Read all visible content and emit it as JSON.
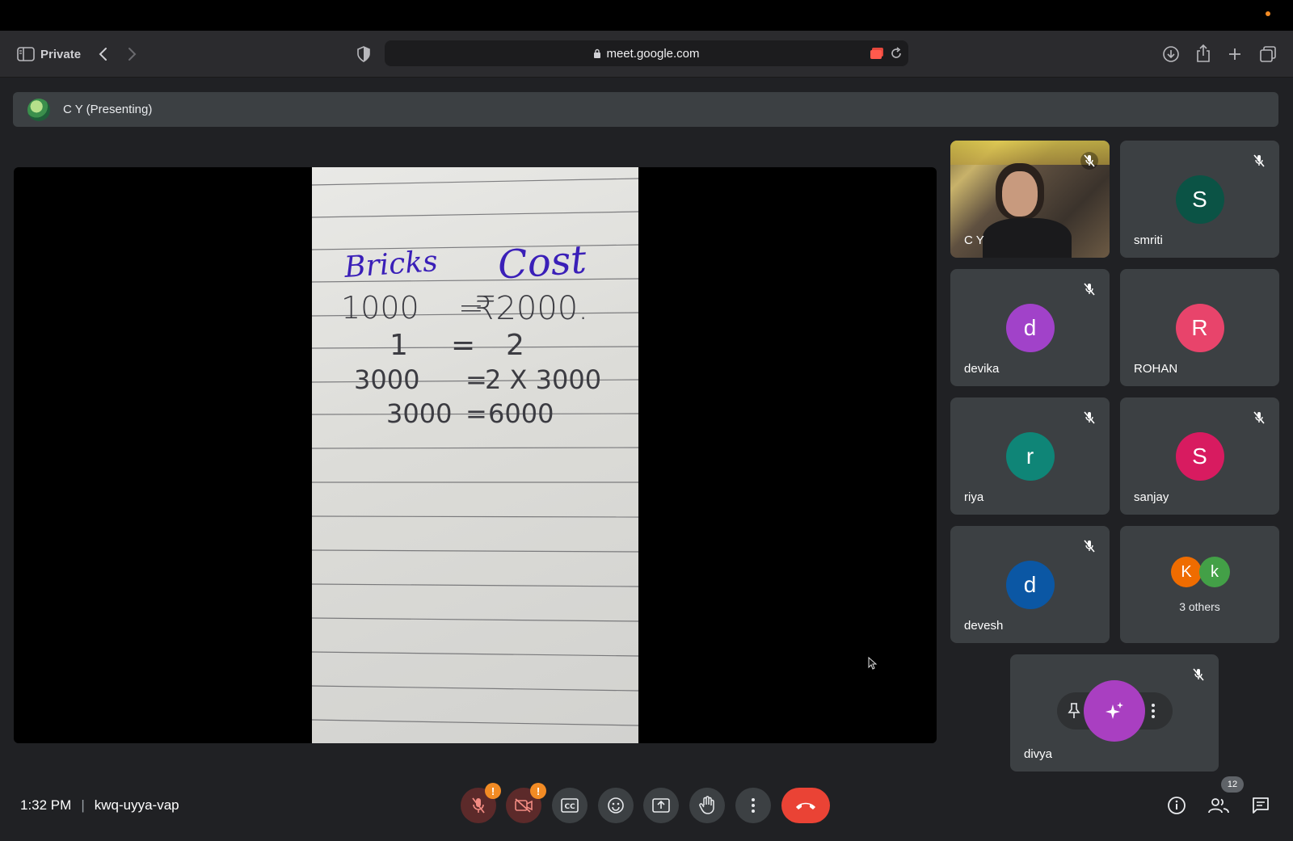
{
  "browser": {
    "mode_label": "Private",
    "url": "meet.google.com"
  },
  "banner": {
    "presenter_label": "C Y (Presenting)"
  },
  "presentation": {
    "notes": {
      "col1_header": "Bricks",
      "col2_header": "Cost",
      "rows": [
        {
          "left": "1000",
          "eq": "=",
          "right": "₹2000."
        },
        {
          "left": "1",
          "eq": "=",
          "right": "2"
        },
        {
          "left": "3000",
          "eq": "=",
          "right": "2 X 3000"
        },
        {
          "left": "3000",
          "eq": "=",
          "right": "6000"
        }
      ]
    }
  },
  "participants": [
    {
      "name": "C Y",
      "type": "video",
      "muted": true
    },
    {
      "name": "smriti",
      "initial": "S",
      "color": "#0b5345",
      "muted": true
    },
    {
      "name": "devika",
      "initial": "d",
      "color": "#a142c9",
      "muted": true
    },
    {
      "name": "ROHAN",
      "initial": "R",
      "color": "#e8446b",
      "muted": false
    },
    {
      "name": "riya",
      "initial": "r",
      "color": "#0f8577",
      "muted": true
    },
    {
      "name": "sanjay",
      "initial": "S",
      "color": "#d81b60",
      "muted": true
    },
    {
      "name": "devesh",
      "initial": "d",
      "color": "#0b57a4",
      "muted": true
    }
  ],
  "others_tile": {
    "label": "3 others",
    "avatars": [
      {
        "initial": "K",
        "color": "#ef6c00"
      },
      {
        "initial": "k",
        "color": "#43a047"
      }
    ]
  },
  "self_tile": {
    "name": "divya",
    "muted": true
  },
  "meeting": {
    "time": "1:32 PM",
    "separator": "|",
    "code": "kwq-uyya-vap",
    "people_count": "12"
  },
  "colors": {
    "hangup": "#ea4335",
    "warning": "#f28b24",
    "tile_bg": "#3c4043"
  }
}
